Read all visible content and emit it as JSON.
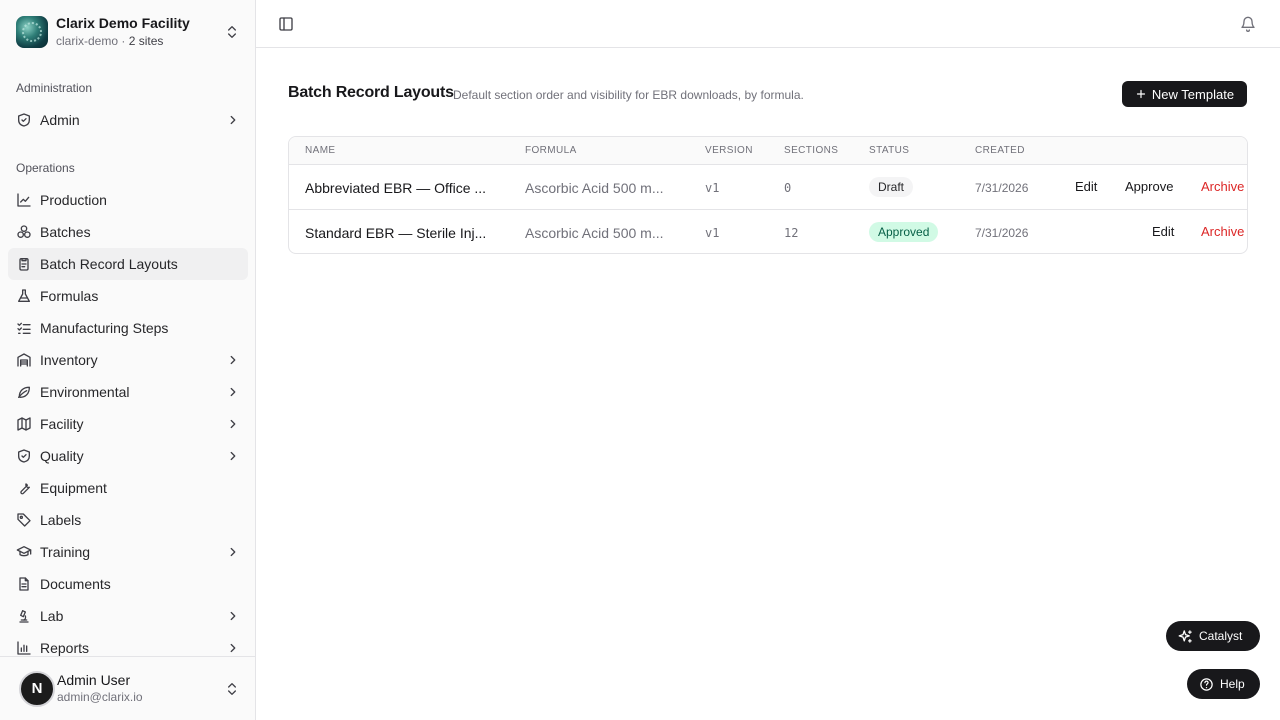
{
  "org": {
    "name": "Clarix Demo Facility",
    "slug": "clarix-demo",
    "sites": "2 sites"
  },
  "sidebar": {
    "admin_label": "Administration",
    "admin_items": [
      {
        "label": "Admin",
        "icon": "shield-check-icon"
      }
    ],
    "ops_label": "Operations",
    "ops_items": [
      {
        "label": "Production",
        "icon": "chart-line-icon"
      },
      {
        "label": "Batches",
        "icon": "boxes-icon"
      },
      {
        "label": "Batch Record Layouts",
        "icon": "clipboard-icon"
      },
      {
        "label": "Formulas",
        "icon": "flask-icon"
      },
      {
        "label": "Manufacturing Steps",
        "icon": "list-checks-icon"
      },
      {
        "label": "Inventory",
        "icon": "warehouse-icon"
      },
      {
        "label": "Environmental",
        "icon": "leaf-icon"
      },
      {
        "label": "Facility",
        "icon": "map-icon"
      },
      {
        "label": "Quality",
        "icon": "shield-check-icon"
      },
      {
        "label": "Equipment",
        "icon": "wrench-icon"
      },
      {
        "label": "Labels",
        "icon": "tag-icon"
      },
      {
        "label": "Training",
        "icon": "graduation-cap-icon"
      },
      {
        "label": "Documents",
        "icon": "file-text-icon"
      },
      {
        "label": "Lab",
        "icon": "microscope-icon"
      },
      {
        "label": "Reports",
        "icon": "bar-chart-icon"
      }
    ]
  },
  "user": {
    "name": "Admin User",
    "email": "admin@clarix.io",
    "initial": "N"
  },
  "page": {
    "title": "Batch Record Layouts",
    "description": "Default section order and visibility for EBR downloads, by formula.",
    "new_button": "New Template"
  },
  "table": {
    "headers": {
      "name": "NAME",
      "formula": "FORMULA",
      "version": "VERSION",
      "sections": "SECTIONS",
      "status": "STATUS",
      "created": "CREATED"
    },
    "rows": [
      {
        "name": "Abbreviated EBR — Office ...",
        "formula": "Ascorbic Acid 500 m...",
        "version": "v1",
        "sections": "0",
        "status": "Draft",
        "created": "7/31/2026",
        "edit": "Edit",
        "approve": "Approve",
        "archive": "Archive"
      },
      {
        "name": "Standard EBR — Sterile Inj...",
        "formula": "Ascorbic Acid 500 m...",
        "version": "v1",
        "sections": "12",
        "status": "Approved",
        "created": "7/31/2026",
        "edit": "Edit",
        "archive": "Archive"
      }
    ]
  },
  "floating": {
    "catalyst": "Catalyst",
    "help": "Help"
  },
  "colors": {
    "accent": "#18181b",
    "danger": "#dc2626",
    "approved_bg": "#d1fae5",
    "approved_text": "#065f46"
  }
}
